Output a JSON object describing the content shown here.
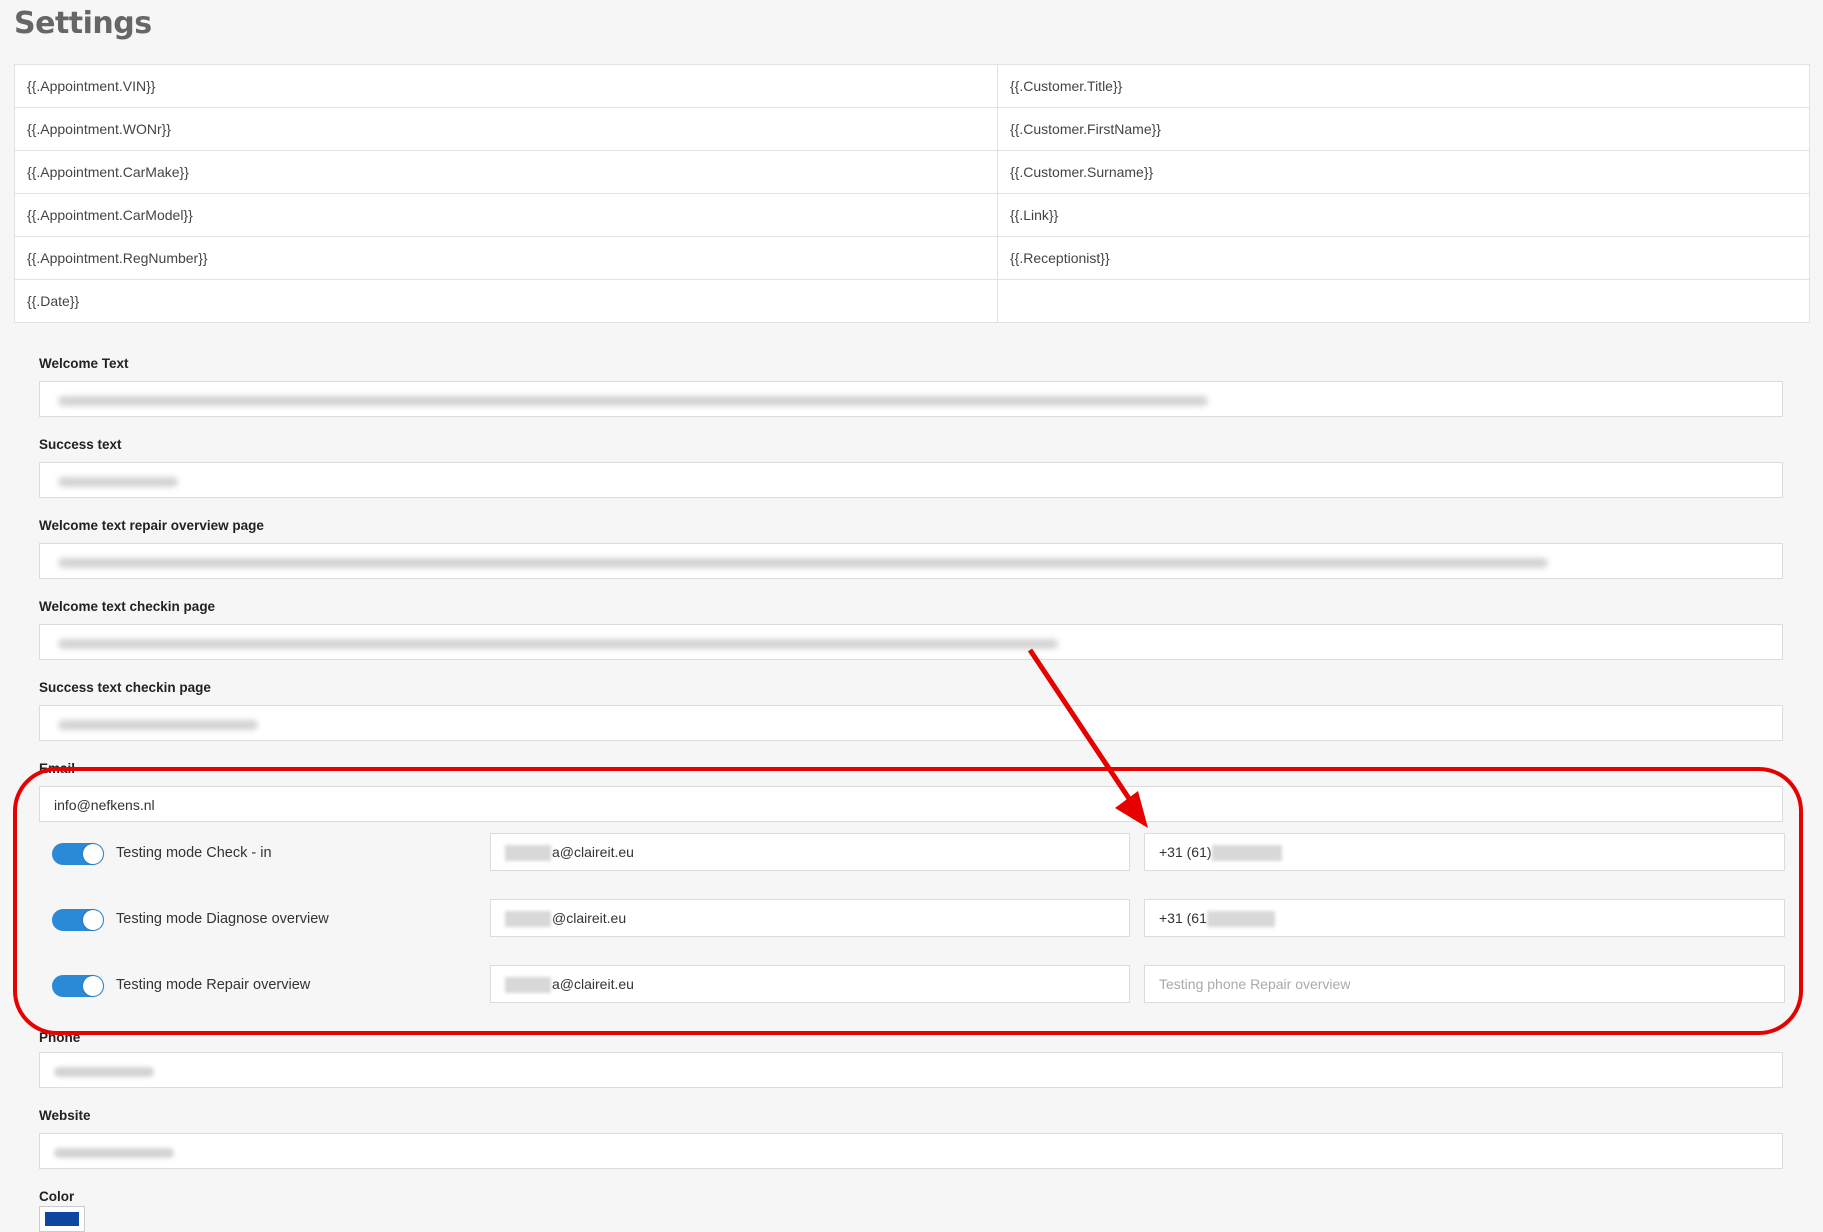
{
  "page": {
    "title": "Settings"
  },
  "tags": {
    "left": [
      "{{.Appointment.VIN}}",
      "{{.Appointment.WONr}}",
      "{{.Appointment.CarMake}}",
      "{{.Appointment.CarModel}}",
      "{{.Appointment.RegNumber}}",
      "{{.Date}}"
    ],
    "right": [
      "{{.Customer.Title}}",
      "{{.Customer.FirstName}}",
      "{{.Customer.Surname}}",
      "{{.Link}}",
      "{{.Receptionist}}",
      ""
    ]
  },
  "form": {
    "welcome_text": {
      "label": "Welcome Text"
    },
    "success_text": {
      "label": "Success text"
    },
    "welcome_repair": {
      "label": "Welcome text repair overview page"
    },
    "welcome_checkin": {
      "label": "Welcome text checkin page"
    },
    "success_checkin": {
      "label": "Success text checkin page"
    },
    "email": {
      "label": "Email",
      "value": "info@nefkens.nl"
    },
    "phone": {
      "label": "Phone"
    },
    "website": {
      "label": "Website"
    },
    "color": {
      "label": "Color",
      "value": "#0d47a1"
    }
  },
  "testing": [
    {
      "label": "Testing mode Check - in",
      "enabled": true,
      "email_suffix": "a@claireit.eu",
      "phone": "+31 (61)",
      "phone_placeholder": ""
    },
    {
      "label": "Testing mode Diagnose overview",
      "enabled": true,
      "email_suffix": "@claireit.eu",
      "phone": "+31 (61",
      "phone_placeholder": ""
    },
    {
      "label": "Testing mode Repair overview",
      "enabled": true,
      "email_suffix": "a@claireit.eu",
      "phone": "",
      "phone_placeholder": "Testing phone Repair overview"
    }
  ],
  "annotation": {
    "highlight_color": "#e60000",
    "toggle_color": "#2b8ad8"
  }
}
